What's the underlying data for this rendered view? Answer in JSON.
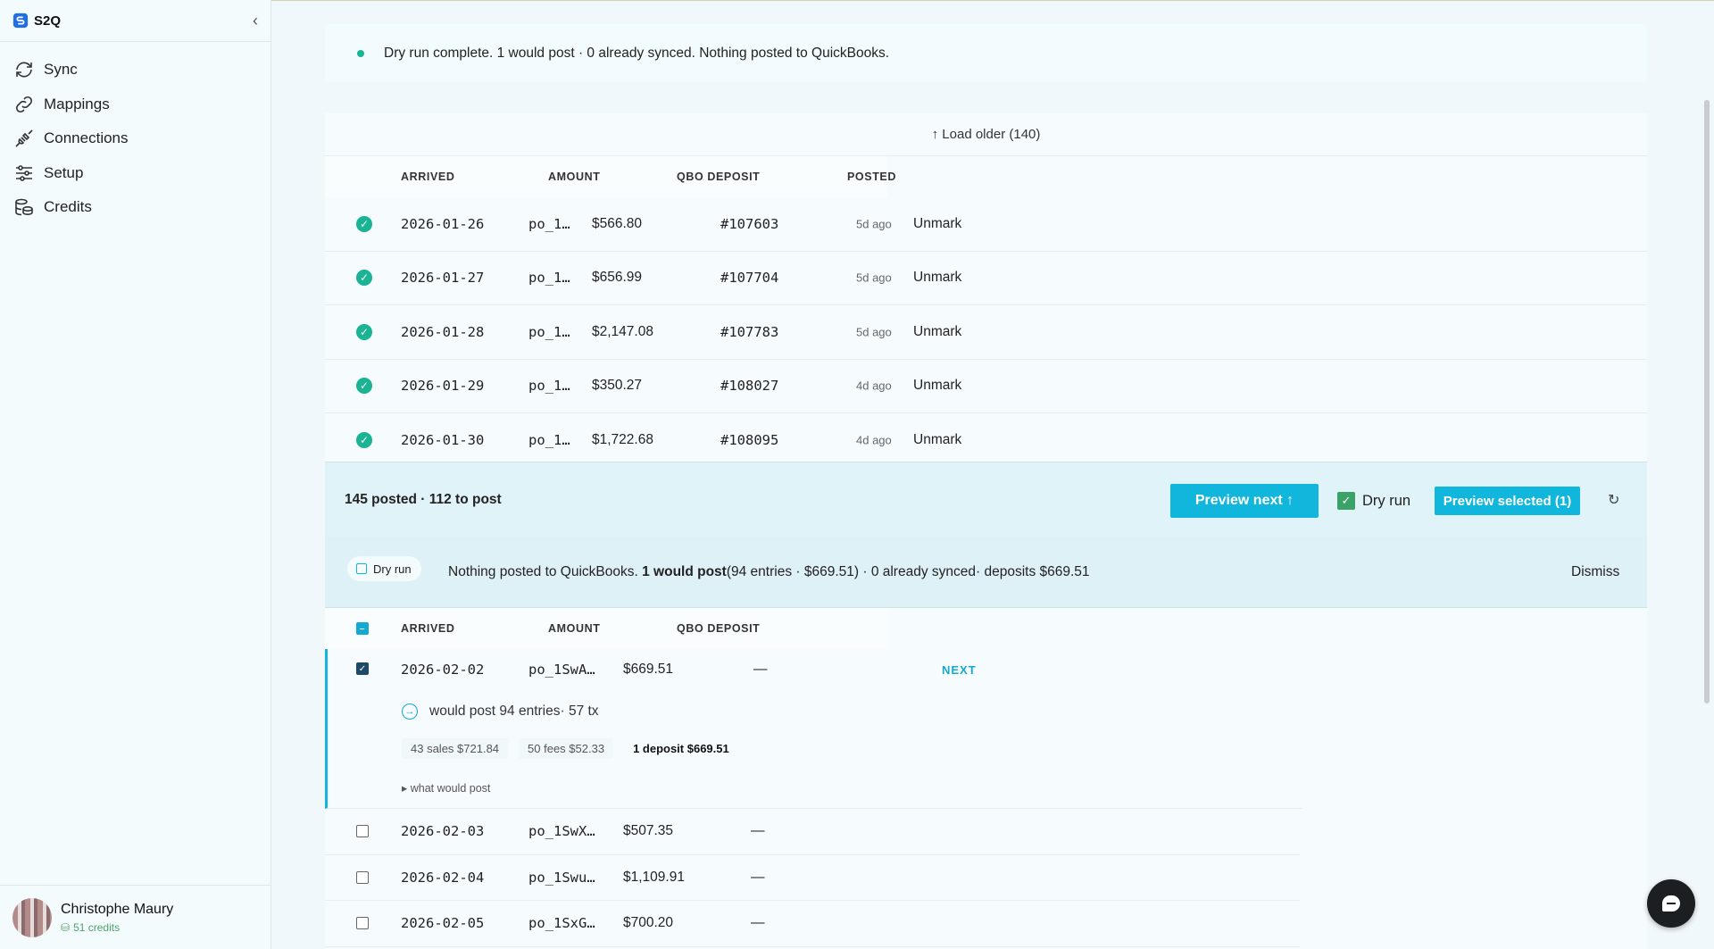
{
  "app": {
    "name": "S2Q"
  },
  "sidebar": {
    "items": [
      {
        "label": "Sync",
        "icon": "sync-icon"
      },
      {
        "label": "Mappings",
        "icon": "link-icon"
      },
      {
        "label": "Connections",
        "icon": "plug-icon"
      },
      {
        "label": "Setup",
        "icon": "sliders-icon"
      },
      {
        "label": "Credits",
        "icon": "coins-icon"
      }
    ],
    "user": {
      "name": "Christophe Maury",
      "credits": "51 credits"
    }
  },
  "banner": {
    "text": "Dry run complete. 1 would post · 0 already synced. Nothing posted to QuickBooks."
  },
  "posted": {
    "load_older": "↑ Load older (140)",
    "headers": {
      "arrived": "ARRIVED",
      "amount": "AMOUNT",
      "qbo_deposit": "QBO DEPOSIT",
      "posted": "POSTED"
    },
    "rows": [
      {
        "date": "2026-01-26",
        "payout": "po_1…",
        "amount": "$566.80",
        "deposit": "#107603",
        "ago": "5d ago",
        "action": "Unmark"
      },
      {
        "date": "2026-01-27",
        "payout": "po_1…",
        "amount": "$656.99",
        "deposit": "#107704",
        "ago": "5d ago",
        "action": "Unmark"
      },
      {
        "date": "2026-01-28",
        "payout": "po_1…",
        "amount": "$2,147.08",
        "deposit": "#107783",
        "ago": "5d ago",
        "action": "Unmark"
      },
      {
        "date": "2026-01-29",
        "payout": "po_1…",
        "amount": "$350.27",
        "deposit": "#108027",
        "ago": "4d ago",
        "action": "Unmark"
      },
      {
        "date": "2026-01-30",
        "payout": "po_1…",
        "amount": "$1,722.68",
        "deposit": "#108095",
        "ago": "4d ago",
        "action": "Unmark"
      }
    ]
  },
  "actionbar": {
    "counts": "145 posted · 112 to post",
    "preview_next": "Preview next ↑",
    "dry_run": "Dry run",
    "preview_selected": "Preview selected (1)",
    "refresh_icon": "↻"
  },
  "result": {
    "pill": "Dry run",
    "msg_pre": "Nothing posted to QuickBooks. ",
    "msg_bold": "1 would post",
    "msg_post": "(94 entries · $669.51) · 0 already synced· deposits $669.51",
    "dismiss": "Dismiss"
  },
  "pending": {
    "headers": {
      "arrived": "ARRIVED",
      "amount": "AMOUNT",
      "qbo_deposit": "QBO DEPOSIT"
    },
    "selected": {
      "date": "2026-02-02",
      "payout": "po_1SwA…",
      "amount": "$669.51",
      "deposit": "—",
      "tag": "NEXT",
      "would_post": "would post 94 entries· 57 tx",
      "chips": [
        "43 sales $721.84",
        "50 fees $52.33",
        "1 deposit $669.51"
      ],
      "details": "▸ what would post"
    },
    "rows": [
      {
        "date": "2026-02-03",
        "payout": "po_1SwX…",
        "amount": "$507.35",
        "deposit": "—"
      },
      {
        "date": "2026-02-04",
        "payout": "po_1Swu…",
        "amount": "$1,109.91",
        "deposit": "—"
      },
      {
        "date": "2026-02-05",
        "payout": "po_1SxG…",
        "amount": "$700.20",
        "deposit": "—"
      }
    ]
  },
  "colors": {
    "accent": "#11b6dc",
    "success": "#1ab394",
    "sidebar_bg": "#f3fbfd"
  }
}
